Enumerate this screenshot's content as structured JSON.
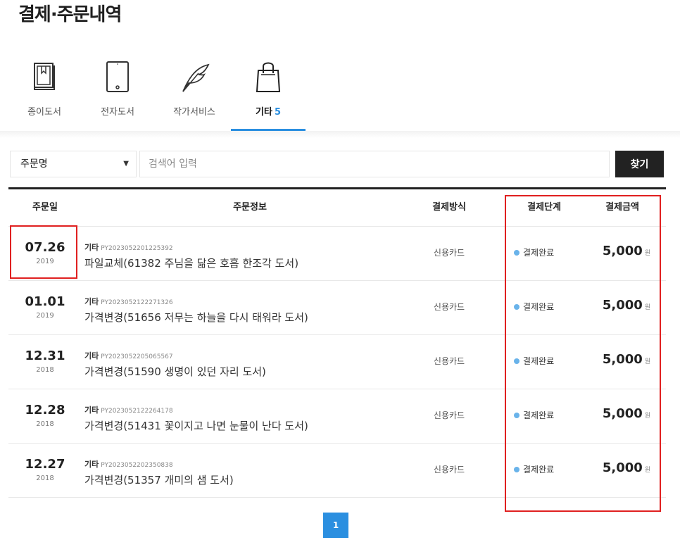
{
  "page": {
    "title": "결제·주문내역"
  },
  "tabs": [
    {
      "label": "종이도서",
      "icon": "book-icon",
      "count": ""
    },
    {
      "label": "전자도서",
      "icon": "tablet-icon",
      "count": ""
    },
    {
      "label": "작가서비스",
      "icon": "quill-icon",
      "count": ""
    },
    {
      "label": "기타",
      "icon": "shopping-bag-icon",
      "count": "5",
      "active": true
    }
  ],
  "search": {
    "select_value": "주문명",
    "placeholder": "검색어 입력",
    "button_label": "찾기"
  },
  "table": {
    "headers": [
      "주문일",
      "주문정보",
      "결제방식",
      "결제단계",
      "결제금액"
    ],
    "rows": [
      {
        "date": "07.26",
        "year": "2019",
        "category": "기타",
        "order_id": "PY2023052201225392",
        "title": "파일교체(61382 주님을 닮은 호흡 한조각 도서)",
        "payment": "신용카드",
        "step": "결제완료",
        "amount": "5,000",
        "unit": "원"
      },
      {
        "date": "01.01",
        "year": "2019",
        "category": "기타",
        "order_id": "PY2023052122271326",
        "title": "가격변경(51656 저무는 하늘을 다시 태워라 도서)",
        "payment": "신용카드",
        "step": "결제완료",
        "amount": "5,000",
        "unit": "원"
      },
      {
        "date": "12.31",
        "year": "2018",
        "category": "기타",
        "order_id": "PY2023052205065567",
        "title": "가격변경(51590 생명이 있던 자리 도서)",
        "payment": "신용카드",
        "step": "결제완료",
        "amount": "5,000",
        "unit": "원"
      },
      {
        "date": "12.28",
        "year": "2018",
        "category": "기타",
        "order_id": "PY2023052122264178",
        "title": "가격변경(51431 꽃이지고 나면 눈물이 난다 도서)",
        "payment": "신용카드",
        "step": "결제완료",
        "amount": "5,000",
        "unit": "원"
      },
      {
        "date": "12.27",
        "year": "2018",
        "category": "기타",
        "order_id": "PY2023052202350838",
        "title": "가격변경(51357 개미의 샘 도서)",
        "payment": "신용카드",
        "step": "결제완료",
        "amount": "5,000",
        "unit": "원"
      }
    ]
  },
  "pagination": {
    "current": "1"
  },
  "colors": {
    "accent": "#2b8fe0",
    "status_dot": "#69b3ea",
    "highlight": "#e02020",
    "button_dark": "#222222"
  }
}
